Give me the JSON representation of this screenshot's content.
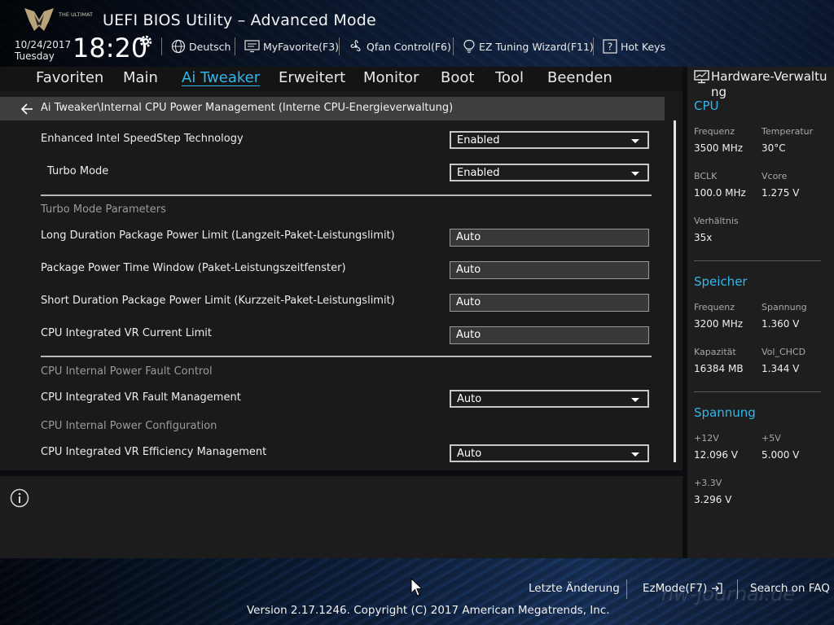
{
  "window": {
    "logo_text": "THE ULTIMATE FORCE",
    "title": "UEFI BIOS Utility – Advanced Mode"
  },
  "clock": {
    "date": "10/24/2017",
    "day": "Tuesday",
    "time": "18:20"
  },
  "toolbar": {
    "language": "Deutsch",
    "favorite": "MyFavorite(F3)",
    "qfan": "Qfan Control(F6)",
    "ez_tuning": "EZ Tuning Wizard(F11)",
    "hot_keys": "Hot Keys"
  },
  "menu": {
    "items": [
      "Favoriten",
      "Main",
      "Ai Tweaker",
      "Erweitert",
      "Monitor",
      "Boot",
      "Tool",
      "Beenden"
    ],
    "active": "Ai Tweaker"
  },
  "breadcrumb": "Ai Tweaker\\Internal CPU Power Management (Interne CPU-Energieverwaltung)",
  "settings": {
    "speedstep": {
      "label": "Enhanced Intel SpeedStep Technology",
      "value": "Enabled"
    },
    "turbo": {
      "label": "Turbo Mode",
      "value": "Enabled"
    },
    "turbo_params_header": "Turbo Mode Parameters",
    "long_duration": {
      "label": "Long Duration Package Power Limit (Langzeit-Paket-Leistungslimit)",
      "value": "Auto"
    },
    "time_window": {
      "label": "Package Power Time Window (Paket-Leistungszeitfenster)",
      "value": "Auto"
    },
    "short_duration": {
      "label": "Short Duration Package Power Limit (Kurzzeit-Paket-Leistungslimit)",
      "value": "Auto"
    },
    "vr_current": {
      "label": "CPU Integrated VR Current Limit",
      "value": "Auto"
    },
    "fault_header": "CPU Internal Power Fault Control",
    "vr_fault": {
      "label": "CPU Integrated VR Fault Management",
      "value": "Auto"
    },
    "config_header": "CPU Internal Power Configuration",
    "vr_efficiency": {
      "label": "CPU Integrated VR Efficiency Management",
      "value": "Auto"
    }
  },
  "hardware": {
    "title": "Hardware-Verwaltung",
    "cpu": {
      "header": "CPU",
      "freq_label": "Frequenz",
      "freq": "3500 MHz",
      "temp_label": "Temperatur",
      "temp": "30°C",
      "bclk_label": "BCLK",
      "bclk": "100.0 MHz",
      "vcore_label": "Vcore",
      "vcore": "1.275 V",
      "ratio_label": "Verhältnis",
      "ratio": "35x"
    },
    "memory": {
      "header": "Speicher",
      "freq_label": "Frequenz",
      "freq": "3200 MHz",
      "volt_label": "Spannung",
      "volt": "1.360 V",
      "cap_label": "Kapazität",
      "cap": "16384 MB",
      "chcd_label": "Vol_CHCD",
      "chcd": "1.344 V"
    },
    "voltage": {
      "header": "Spannung",
      "v12_label": "+12V",
      "v12": "12.096 V",
      "v5_label": "+5V",
      "v5": "5.000 V",
      "v33_label": "+3.3V",
      "v33": "3.296 V"
    }
  },
  "footer": {
    "last_change": "Letzte Änderung",
    "ezmode": "EzMode(F7)",
    "faq": "Search on FAQ",
    "copyright": "Version 2.17.1246. Copyright (C) 2017 American Megatrends, Inc.",
    "watermark": "hw-journal.de"
  },
  "colors": {
    "accent": "#33b6ec",
    "background": "#1a1a1a",
    "breadcrumb": "#3f3f3f"
  }
}
